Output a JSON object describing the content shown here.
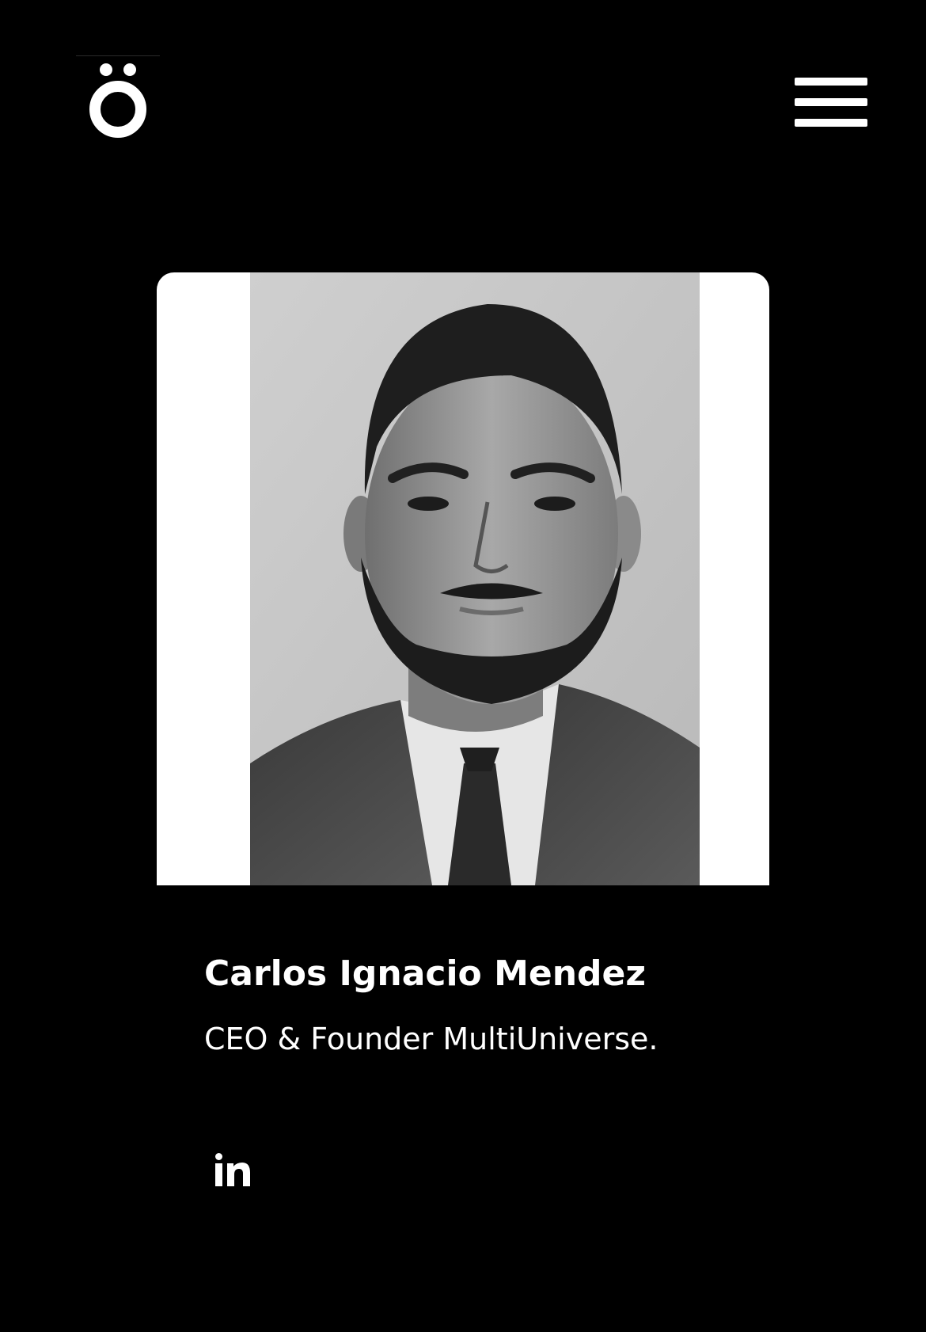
{
  "header": {
    "logo_icon": "o-umlaut-logo",
    "menu_icon": "hamburger-menu-icon"
  },
  "profile": {
    "name": "Carlos Ignacio Mendez",
    "role": "CEO & Founder MultiUniverse.",
    "photo_style": "black-and-white portrait"
  },
  "social": {
    "linkedin_icon": "linkedin-icon"
  },
  "colors": {
    "background": "#000000",
    "text": "#ffffff",
    "card": "#ffffff"
  }
}
